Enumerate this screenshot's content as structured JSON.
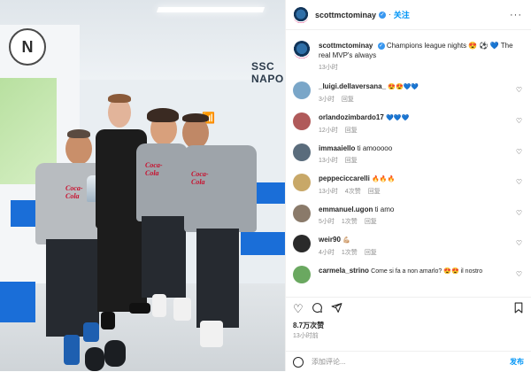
{
  "photo": {
    "wall_logo_letter": "N",
    "wall_brand_text": "SSC NAPO",
    "shirt_sponsor": "Coca-Cola"
  },
  "header": {
    "username": "scottmctominay",
    "follow_label": "关注",
    "more_label": "···"
  },
  "caption": {
    "username": "scottmctominay",
    "text": "Champions league nights 😍 ⚽ 💙 The real MVP's always",
    "time": "13小时"
  },
  "comments": [
    {
      "username": "_luigi.dellaversana_",
      "text": "😍😍💙💙",
      "time": "3小时",
      "reply": "回复",
      "likes": ""
    },
    {
      "username": "orlandozimbardo17",
      "text": "💙💙💙",
      "time": "12小时",
      "reply": "回复",
      "likes": ""
    },
    {
      "username": "immaaiello",
      "text": "ti amooooo",
      "time": "13小时",
      "reply": "回复",
      "likes": ""
    },
    {
      "username": "peppeciccarelli",
      "text": "🔥🔥🔥",
      "time": "13小时",
      "reply": "回复",
      "likes": "4次赞"
    },
    {
      "username": "emmanuel.ugon",
      "text": "ti amo",
      "time": "5小时",
      "reply": "回复",
      "likes": "1次赞"
    },
    {
      "username": "weir90",
      "text": "💪🏼",
      "time": "4小时",
      "reply": "回复",
      "likes": "1次赞"
    },
    {
      "username": "carmela_strino",
      "text": "Come si fa a non amarlo? 😍😍 il nostro",
      "time": "",
      "reply": "",
      "likes": ""
    }
  ],
  "actions": {
    "like_icon": "heart-icon",
    "comment_icon": "comment-icon",
    "share_icon": "share-icon",
    "save_icon": "bookmark-icon"
  },
  "stats": {
    "likes": "8.7万次赞",
    "time": "13小时前"
  },
  "add_comment": {
    "placeholder": "添加评论...",
    "post_label": "发布"
  }
}
